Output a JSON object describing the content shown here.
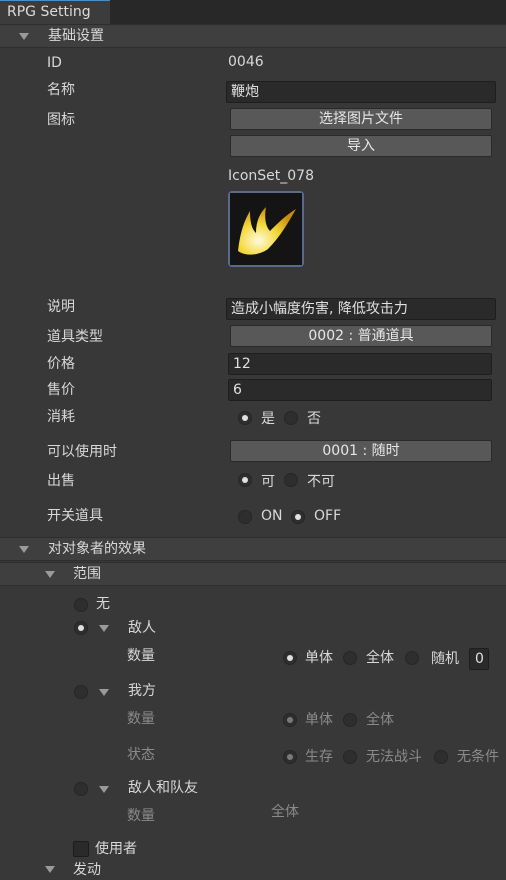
{
  "tab": {
    "title": "RPG Setting"
  },
  "sections": {
    "basic": "基础设置",
    "effects": "对对象者的效果",
    "scope": "范围",
    "next_partial": "发动"
  },
  "basic": {
    "id_label": "ID",
    "id_value": "0046",
    "name_label": "名称",
    "name_value": "鞭炮",
    "icon_label": "图标",
    "choose_image_btn": "选择图片文件",
    "import_btn": "导入",
    "icon_name": "IconSet_078",
    "desc_label": "说明",
    "desc_value": "造成小幅度伤害, 降低攻击力",
    "type_label": "道具类型",
    "type_value": "0002 : 普通道具",
    "price_label": "价格",
    "price_value": "12",
    "sell_label": "售价",
    "sell_value": "6",
    "consume_label": "消耗",
    "consume_yes": "是",
    "consume_no": "否",
    "usable_label": "可以使用时",
    "usable_value": "0001 : 随时",
    "sale_label": "出售",
    "sale_yes": "可",
    "sale_no": "不可",
    "switch_label": "开关道具",
    "switch_on": "ON",
    "switch_off": "OFF"
  },
  "scope": {
    "none": "无",
    "enemy": "敌人",
    "count_label": "数量",
    "single": "单体",
    "all": "全体",
    "random": "随机",
    "random_count": "0",
    "ally": "我方",
    "state_label": "状态",
    "alive": "生存",
    "dead": "无法战斗",
    "unconditional": "无条件",
    "enemy_and_ally": "敌人和队友",
    "user": "使用者"
  },
  "colors": {
    "tab_accent": "#4a90c8",
    "icon_border": "#5a6a88",
    "icon_flame": "#f0d030"
  }
}
